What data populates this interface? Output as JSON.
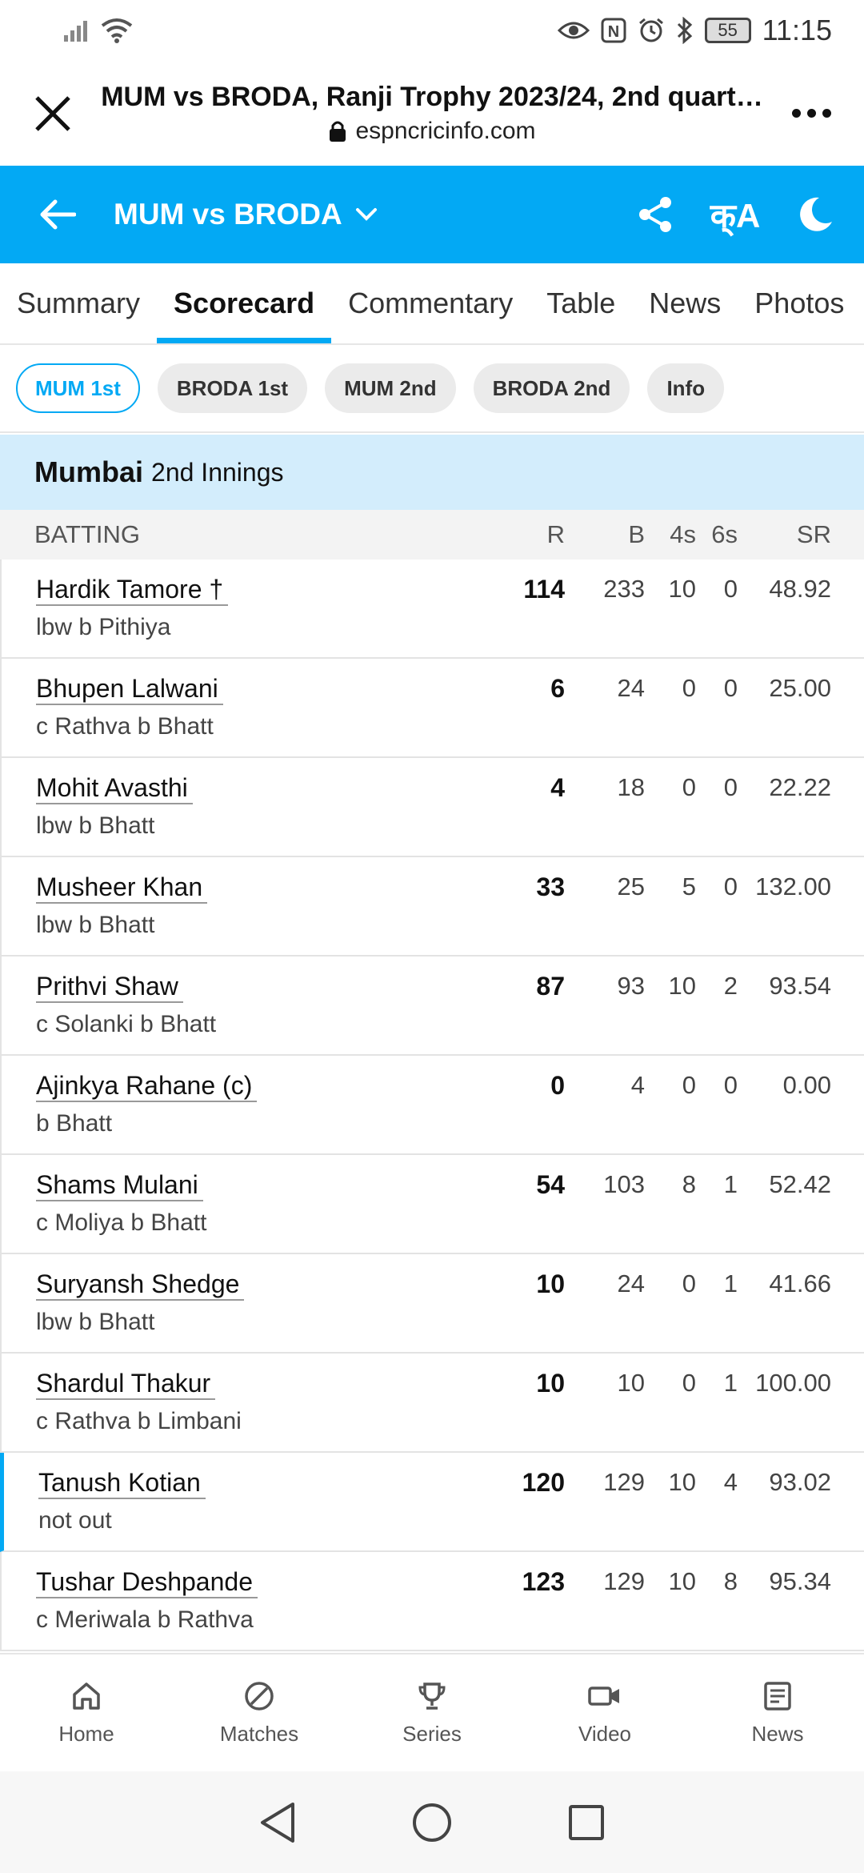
{
  "status_bar": {
    "time": "11:15",
    "battery": "55",
    "icons": [
      "signal-icon",
      "wifi-icon",
      "eye-icon",
      "nfc-icon",
      "alarm-icon",
      "bluetooth-icon",
      "battery-icon"
    ]
  },
  "browser": {
    "title": "MUM vs BRODA, Ranji Trophy 2023/24, 2nd quart…",
    "domain": "espncricinfo.com"
  },
  "header": {
    "match": "MUM vs BRODA",
    "translate_label": "क्A",
    "accent_color": "#03a9f4"
  },
  "tabs": [
    "Summary",
    "Scorecard",
    "Commentary",
    "Table",
    "News",
    "Photos"
  ],
  "innings_pills": [
    "MUM 1st",
    "BRODA 1st",
    "MUM 2nd",
    "BRODA 2nd",
    "Info"
  ],
  "innings": {
    "team": "Mumbai",
    "label": "2nd Innings"
  },
  "batting": {
    "header": [
      "BATTING",
      "R",
      "B",
      "4s",
      "6s",
      "SR"
    ],
    "rows": [
      {
        "name": "Hardik Tamore †",
        "dismissal": "lbw b Pithiya",
        "r": "114",
        "b": "233",
        "fours": "10",
        "sixes": "0",
        "sr": "48.92"
      },
      {
        "name": "Bhupen Lalwani",
        "dismissal": "c Rathva b Bhatt",
        "r": "6",
        "b": "24",
        "fours": "0",
        "sixes": "0",
        "sr": "25.00"
      },
      {
        "name": "Mohit Avasthi",
        "dismissal": "lbw b Bhatt",
        "r": "4",
        "b": "18",
        "fours": "0",
        "sixes": "0",
        "sr": "22.22"
      },
      {
        "name": "Musheer Khan",
        "dismissal": "lbw b Bhatt",
        "r": "33",
        "b": "25",
        "fours": "5",
        "sixes": "0",
        "sr": "132.00"
      },
      {
        "name": "Prithvi Shaw",
        "dismissal": "c Solanki b Bhatt",
        "r": "87",
        "b": "93",
        "fours": "10",
        "sixes": "2",
        "sr": "93.54"
      },
      {
        "name": "Ajinkya Rahane (c)",
        "dismissal": "b Bhatt",
        "r": "0",
        "b": "4",
        "fours": "0",
        "sixes": "0",
        "sr": "0.00"
      },
      {
        "name": "Shams Mulani",
        "dismissal": "c Moliya b Bhatt",
        "r": "54",
        "b": "103",
        "fours": "8",
        "sixes": "1",
        "sr": "52.42"
      },
      {
        "name": "Suryansh Shedge",
        "dismissal": "lbw b Bhatt",
        "r": "10",
        "b": "24",
        "fours": "0",
        "sixes": "1",
        "sr": "41.66"
      },
      {
        "name": "Shardul Thakur",
        "dismissal": "c Rathva b Limbani",
        "r": "10",
        "b": "10",
        "fours": "0",
        "sixes": "1",
        "sr": "100.00"
      },
      {
        "name": "Tanush Kotian",
        "dismissal": "not out",
        "r": "120",
        "b": "129",
        "fours": "10",
        "sixes": "4",
        "sr": "93.02"
      },
      {
        "name": "Tushar Deshpande",
        "dismissal": "c Meriwala b Rathva",
        "r": "123",
        "b": "129",
        "fours": "10",
        "sixes": "8",
        "sr": "95.34"
      }
    ]
  },
  "bottom_nav": [
    "Home",
    "Matches",
    "Series",
    "Video",
    "News"
  ]
}
